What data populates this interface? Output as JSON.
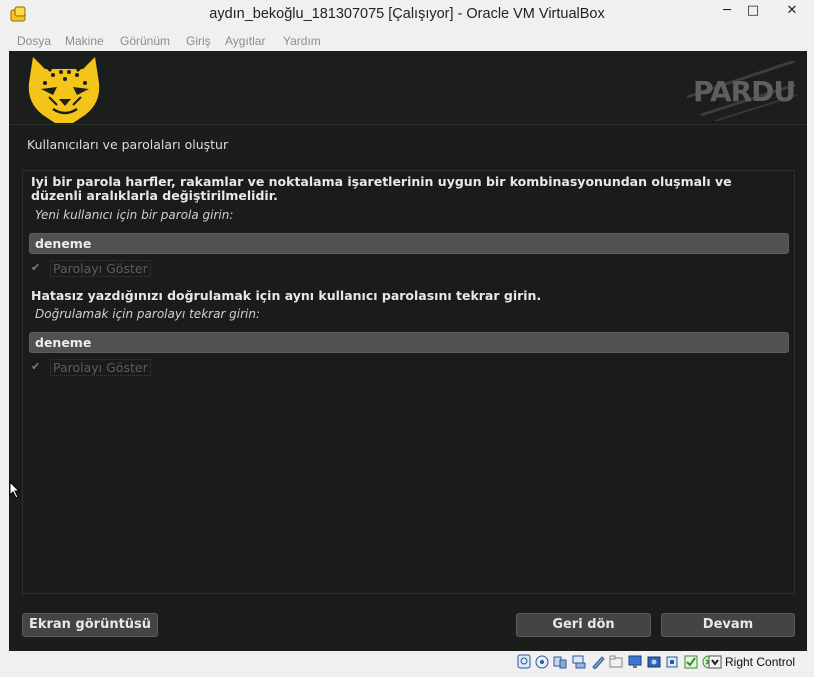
{
  "window": {
    "title": "aydın_bekoğlu_181307075 [Çalışıyor] - Oracle VM VirtualBox",
    "minimize": "─",
    "maximize": "□",
    "close": "✕"
  },
  "menu": [
    "Dosya",
    "Makine",
    "Görünüm",
    "Giriş",
    "Aygıtlar",
    "Yardım"
  ],
  "installer": {
    "brand": "PARDUS",
    "page_title": "Kullanıcıları ve parolaları oluştur",
    "password_help_line1": "Iyi bir parola harfler, rakamlar ve noktalama işaretlerinin uygun bir kombinasyonundan oluşmalı ve",
    "password_help_line2": "düzenli aralıklarla değiştirilmelidir.",
    "password_prompt": "Yeni kullanıcı için bir parola girin:",
    "password_value": "deneme",
    "show_password_label": "Parolayı Göster",
    "show_password_checked": true,
    "verify_help": "Hatasız yazdığınızı doğrulamak için aynı kullanıcı parolasını tekrar girin.",
    "verify_prompt": "Doğrulamak için parolayı tekrar girin:",
    "verify_value": "deneme",
    "show_verify_label": "Parolayı Göster",
    "show_verify_checked": true,
    "checkmark": "✔"
  },
  "buttons": {
    "screenshot": "Ekran görüntüsü",
    "back": "Geri dön",
    "next": "Devam"
  },
  "statusbar": {
    "icons": [
      "hard-disk-icon",
      "optical-drive-icon",
      "audio-icon",
      "network-icon",
      "usb-icon",
      "shared-folders-icon",
      "display-icon",
      "video-capture-icon",
      "cpu-icon",
      "virtualization-icon",
      "mouse-integration-icon",
      "keyboard-capture-icon"
    ],
    "host_key": "Right Control"
  },
  "colors": {
    "guest_bg": "#1b1d1b",
    "logo_yellow": "#f3c51b",
    "field_bg": "#4f524f"
  }
}
